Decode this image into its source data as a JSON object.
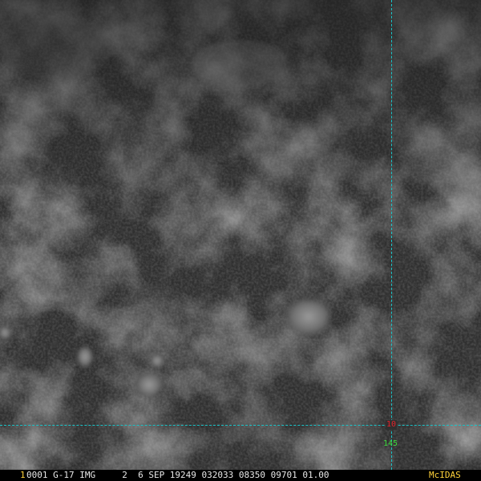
{
  "overlay": {
    "latitude_label": "10",
    "longitude_label": "145",
    "grid_color": "#19c3c8",
    "latitude_color": "#e3232b",
    "longitude_color": "#3ddc3d"
  },
  "status_bar": {
    "frame_number": "1",
    "text": "0001 G-17 IMG     2  6 SEP 19249 032033 08350 09701 01.00",
    "brand": "McIDAS",
    "accent_color": "#ffd23a"
  }
}
